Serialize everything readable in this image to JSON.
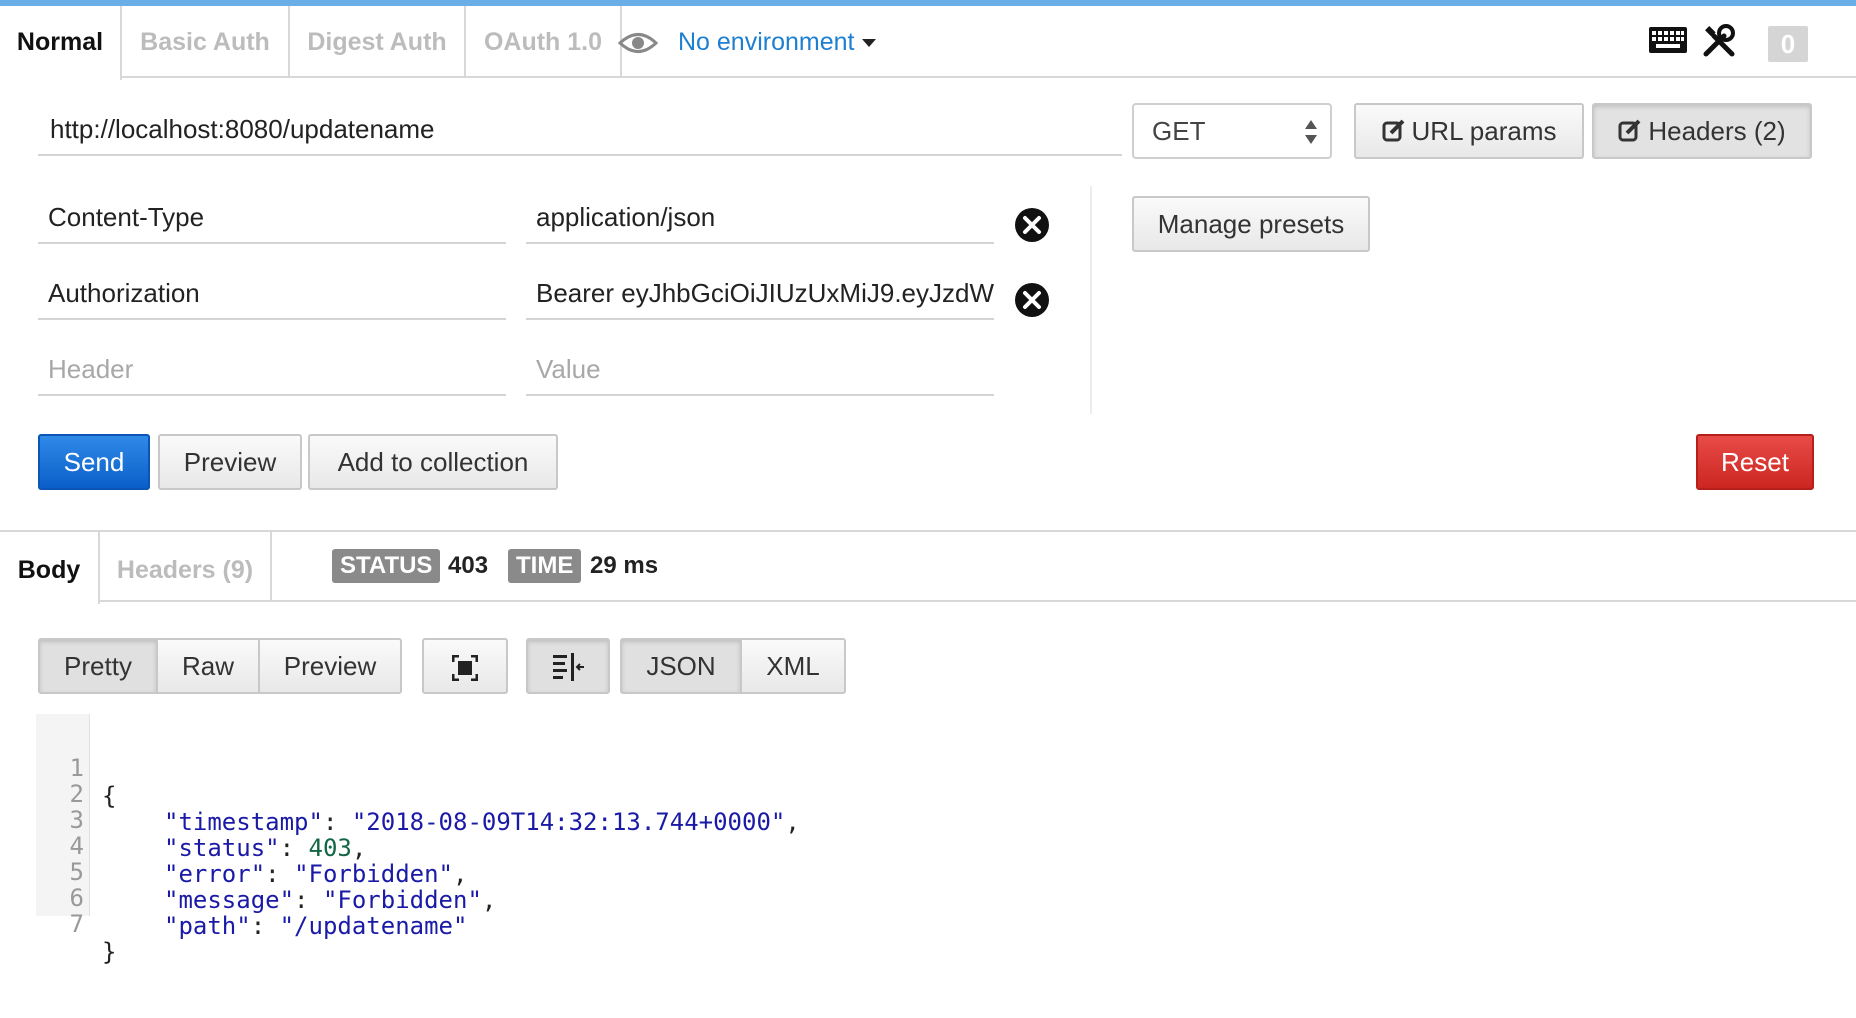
{
  "colors": {
    "accent_bar": "#6aaee8",
    "link": "#1e7fd0",
    "send": "#0b5fc8",
    "reset": "#cc2621",
    "badge": "#8a8a8a"
  },
  "auth_tabs": [
    "Normal",
    "Basic Auth",
    "Digest Auth",
    "OAuth 1.0"
  ],
  "environment": {
    "icon": "eye-icon",
    "label": "No environment"
  },
  "toolbar_icons": [
    "keyboard-icon",
    "tools-icon"
  ],
  "notification_count": "0",
  "request": {
    "url": "http://localhost:8080/updatename",
    "method": "GET",
    "url_params_label": "URL params",
    "headers_label": "Headers (2)",
    "manage_presets_label": "Manage presets"
  },
  "headers": [
    {
      "key": "Content-Type",
      "value": "application/json"
    },
    {
      "key": "Authorization",
      "value": "Bearer eyJhbGciOiJIUzUxMiJ9.eyJzdW"
    }
  ],
  "header_placeholders": {
    "key": "Header",
    "value": "Value"
  },
  "actions": {
    "send": "Send",
    "preview": "Preview",
    "add_to_collection": "Add to collection",
    "reset": "Reset"
  },
  "response": {
    "tabs": [
      "Body",
      "Headers (9)"
    ],
    "status_label": "STATUS",
    "status_value": "403",
    "time_label": "TIME",
    "time_value": "29 ms"
  },
  "viewer": {
    "modes": [
      "Pretty",
      "Raw",
      "Preview"
    ],
    "formats": [
      "JSON",
      "XML"
    ]
  },
  "body_lines": [
    {
      "n": "1",
      "text": "{"
    },
    {
      "n": "2",
      "key": "\"timestamp\"",
      "val": "\"2018-08-09T14:32:13.744+0000\"",
      "type": "s",
      "tail": ","
    },
    {
      "n": "3",
      "key": "\"status\"",
      "val": "403",
      "type": "n",
      "tail": ","
    },
    {
      "n": "4",
      "key": "\"error\"",
      "val": "\"Forbidden\"",
      "type": "s",
      "tail": ","
    },
    {
      "n": "5",
      "key": "\"message\"",
      "val": "\"Forbidden\"",
      "type": "s",
      "tail": ","
    },
    {
      "n": "6",
      "key": "\"path\"",
      "val": "\"/updatename\"",
      "type": "s",
      "tail": ""
    },
    {
      "n": "7",
      "text": "}"
    }
  ]
}
